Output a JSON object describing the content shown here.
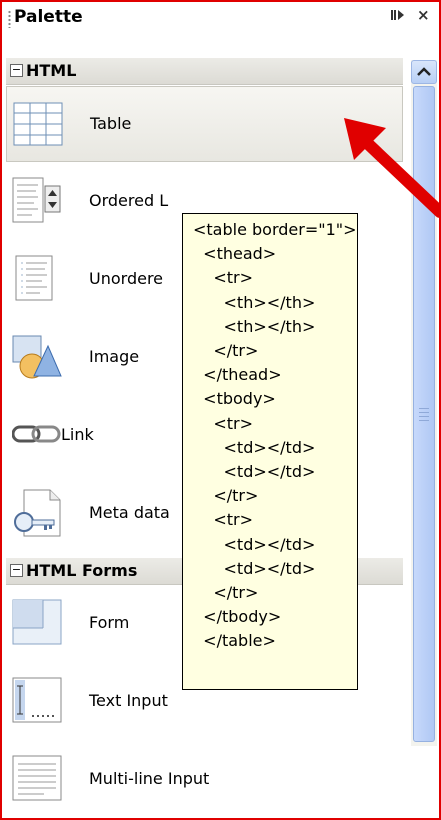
{
  "palette": {
    "title": "Palette",
    "dock_icon": "dock-icon",
    "close_label": "×"
  },
  "categories": [
    {
      "label": "HTML",
      "toggle": "−",
      "items": [
        {
          "label": "Table",
          "icon": "table-icon",
          "selected": true
        },
        {
          "label": "Ordered L",
          "icon": "ordered-list-icon"
        },
        {
          "label": "Unordere",
          "icon": "unordered-list-icon"
        },
        {
          "label": "Image",
          "icon": "image-icon"
        },
        {
          "label": "Link",
          "icon": "link-icon"
        },
        {
          "label": "Meta data",
          "icon": "meta-data-icon"
        }
      ]
    },
    {
      "label": "HTML Forms",
      "toggle": "−",
      "items": [
        {
          "label": "Form",
          "icon": "form-icon"
        },
        {
          "label": "Text Input",
          "icon": "text-input-icon"
        },
        {
          "label": "Multi-line Input",
          "icon": "multiline-input-icon"
        }
      ]
    }
  ],
  "tooltip": {
    "code": "<table border=\"1\">\n  <thead>\n    <tr>\n      <th></th>\n      <th></th>\n    </tr>\n  </thead>\n  <tbody>\n    <tr>\n      <td></td>\n      <td></td>\n    </tr>\n    <tr>\n      <td></td>\n      <td></td>\n    </tr>\n  </tbody>\n  </table>"
  },
  "colors": {
    "frame_border": "#e00000",
    "tooltip_bg": "#ffffe1",
    "arrow": "#e00000",
    "scrollbar": "#b0c8f4"
  }
}
